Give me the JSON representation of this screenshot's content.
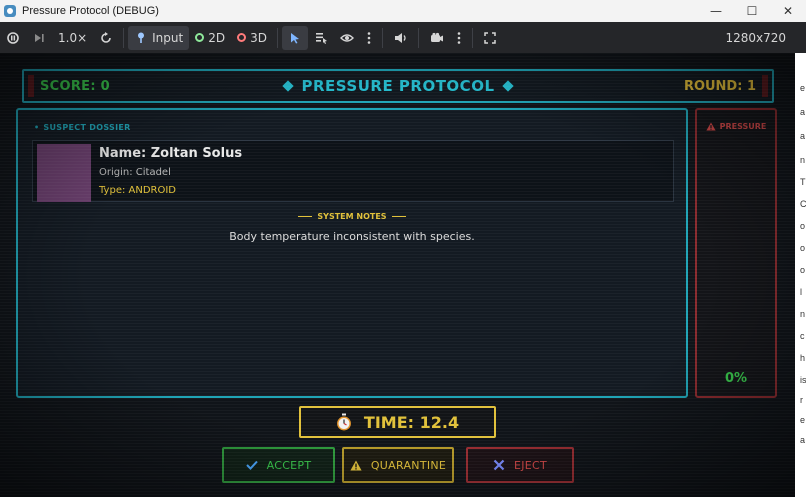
{
  "window": {
    "title": "Pressure Protocol (DEBUG)",
    "controls": {
      "minimize": "—",
      "maximize": "☐",
      "close": "✕"
    }
  },
  "toolbar": {
    "speed": "1.0×",
    "input_label": "Input",
    "view_2d": "2D",
    "view_3d": "3D",
    "resolution": "1280x720"
  },
  "game": {
    "header": {
      "score": "SCORE: 0",
      "title": "PRESSURE PROTOCOL",
      "round": "ROUND: 1"
    },
    "dossier": {
      "section_label": "SUSPECT DOSSIER",
      "suspect": {
        "name": "Name: Zoltan Solus",
        "origin": "Origin: Citadel",
        "type": "Type: ANDROID",
        "portrait_color": "#6a3f6d"
      },
      "notes_label": "SYSTEM NOTES",
      "notes_text": "Body temperature inconsistent with species."
    },
    "pressure": {
      "label": "PRESSURE",
      "value_text": "0%",
      "level": 0
    },
    "timer": {
      "text": "TIME: 12.4"
    },
    "actions": {
      "accept": "ACCEPT",
      "quarantine": "QUARANTINE",
      "eject": "EJECT"
    },
    "colors": {
      "cyan": "#1fa4b6",
      "green": "#38c94c",
      "yellow": "#e1c13a",
      "red": "#d44747"
    }
  },
  "side_strip_letters": [
    "e",
    "a",
    "a",
    "n",
    "T",
    "C",
    "o",
    "o",
    "o",
    "l",
    "n",
    "c",
    "h",
    "is",
    "r",
    "e",
    "a"
  ]
}
